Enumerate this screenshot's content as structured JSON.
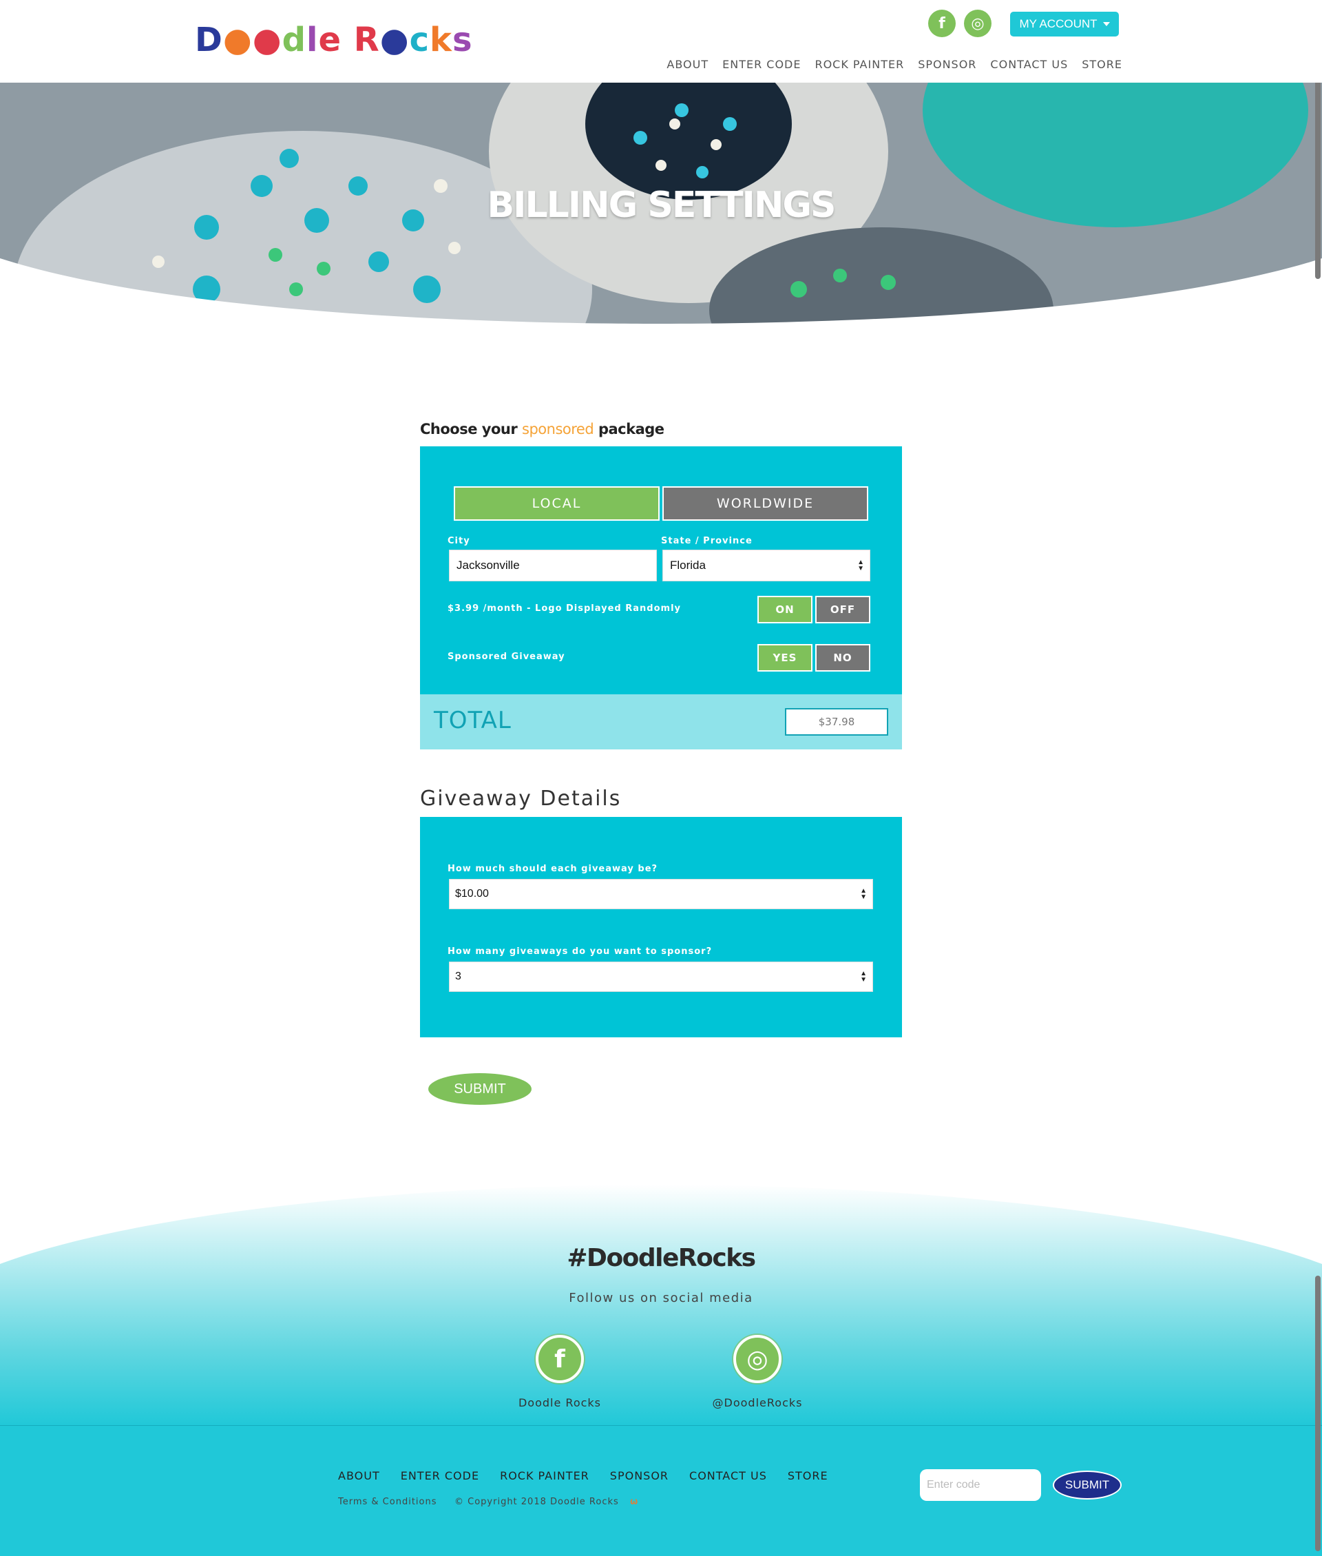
{
  "brand": {
    "logo_text": "Doodle Rocks",
    "colors": {
      "teal": "#00c4d6",
      "green": "#7fc15a",
      "gray": "#757575",
      "navy": "#1e2e8c",
      "orange": "#f5a337"
    }
  },
  "header": {
    "social": [
      {
        "icon": "facebook-icon",
        "glyph": "f"
      },
      {
        "icon": "instagram-icon",
        "glyph": "◎"
      }
    ],
    "account_button": "MY ACCOUNT",
    "nav": [
      "ABOUT",
      "ENTER CODE",
      "ROCK PAINTER",
      "SPONSOR",
      "CONTACT US",
      "STORE"
    ]
  },
  "hero": {
    "title": "BILLING SETTINGS"
  },
  "package": {
    "heading_pre": "Choose your ",
    "heading_highlight": "sponsored",
    "heading_post": " package",
    "tabs": {
      "local": "LOCAL",
      "worldwide": "WORLDWIDE",
      "selected": "LOCAL"
    },
    "city_label": "City",
    "city_value": "Jacksonville",
    "state_label": "State / Province",
    "state_value": "Florida",
    "logo_option_label": "$3.99 /month - Logo Displayed Randomly",
    "logo_on": "ON",
    "logo_off": "OFF",
    "logo_selected": "ON",
    "giveaway_option_label": "Sponsored Giveaway",
    "giveaway_yes": "YES",
    "giveaway_no": "NO",
    "giveaway_selected": "YES",
    "total_label": "TOTAL",
    "total_value": "$37.98"
  },
  "giveaway": {
    "heading": "Giveaway Details",
    "amount_label": "How much should each giveaway be?",
    "amount_value": "$10.00",
    "count_label": "How many giveaways do you want to sponsor?",
    "count_value": "3"
  },
  "submit_label": "SUBMIT",
  "footer": {
    "hashtag": "#DoodleRocks",
    "follow_text": "Follow us on social media",
    "facebook_caption": "Doodle Rocks",
    "instagram_caption": "@DoodleRocks",
    "nav": [
      "ABOUT",
      "ENTER CODE",
      "ROCK PAINTER",
      "SPONSOR",
      "CONTACT US",
      "STORE"
    ],
    "terms": "Terms & Conditions",
    "copyright": "© Copyright 2018 Doodle Rocks",
    "code_placeholder": "Enter code",
    "code_submit": "SUBMIT"
  }
}
